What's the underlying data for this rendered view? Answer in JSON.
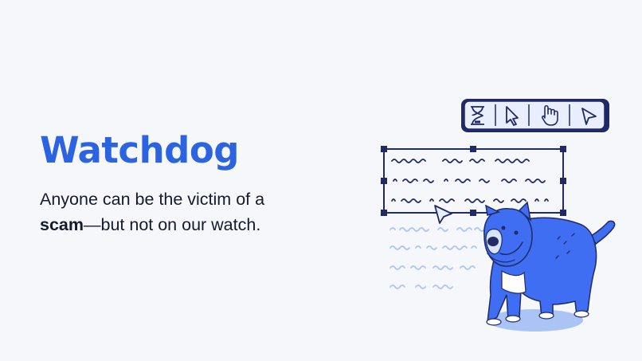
{
  "hero": {
    "title": "Watchdog",
    "tagline_line1": "Anyone can be the victim of a",
    "tagline_bold": "scam",
    "tagline_rest": "—but not on our watch."
  },
  "toolbar_icons": [
    "hourglass-icon",
    "pointer-arrow-icon",
    "hand-cursor-icon",
    "cursor-arrow-icon"
  ],
  "colors": {
    "background": "#f6f7fb",
    "title": "#2b63e0",
    "text": "#141b2e",
    "navy": "#1f2a66",
    "dog_blue": "#3f6ef3",
    "light_blue": "#a9c4f5"
  }
}
